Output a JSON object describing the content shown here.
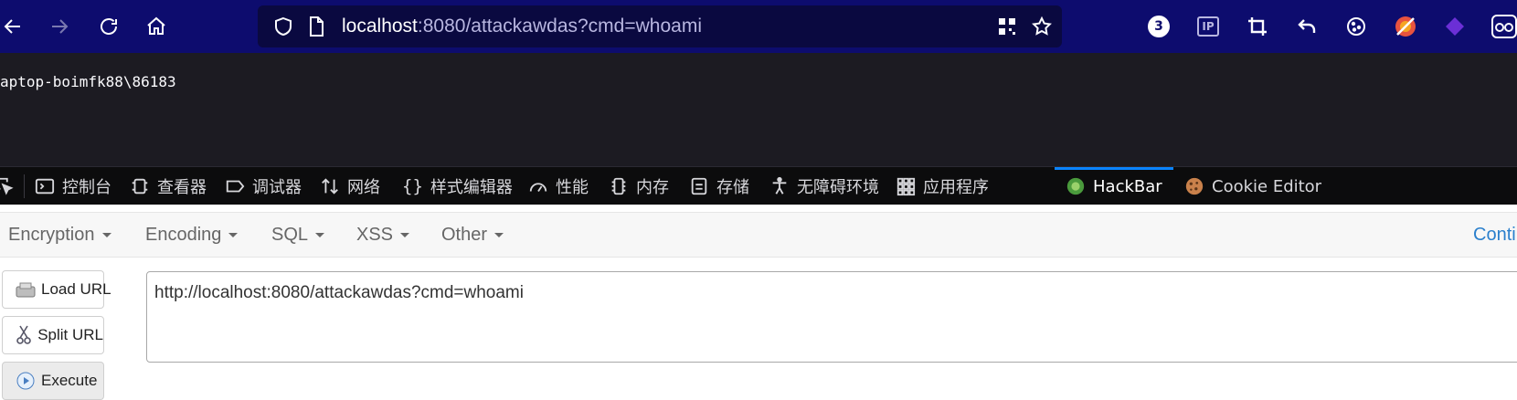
{
  "browser": {
    "url_host": "localhost",
    "url_rest": ":8080/attackawdas?cmd=whoami",
    "badge_count": "3",
    "ext_ip_label": "IP"
  },
  "page": {
    "output_text": "aptop-boimfk88\\86183"
  },
  "devtools": {
    "tabs": [
      {
        "label": "控制台",
        "icon": "console-icon"
      },
      {
        "label": "查看器",
        "icon": "inspector-icon"
      },
      {
        "label": "调试器",
        "icon": "debugger-icon"
      },
      {
        "label": "网络",
        "icon": "network-icon"
      },
      {
        "label": "样式编辑器",
        "icon": "style-editor-icon"
      },
      {
        "label": "性能",
        "icon": "performance-icon"
      },
      {
        "label": "内存",
        "icon": "memory-icon"
      },
      {
        "label": "存储",
        "icon": "storage-icon"
      },
      {
        "label": "无障碍环境",
        "icon": "accessibility-icon"
      },
      {
        "label": "应用程序",
        "icon": "application-icon"
      },
      {
        "label": "HackBar",
        "icon": "hackbar-icon"
      },
      {
        "label": "Cookie Editor",
        "icon": "cookie-icon"
      }
    ],
    "active_tab": "HackBar"
  },
  "hackbar": {
    "menus": [
      "Encryption",
      "Encoding",
      "SQL",
      "XSS",
      "Other"
    ],
    "menu_right": "Conti",
    "buttons": {
      "load": "Load URL",
      "split": "Split URL",
      "execute": "Execute"
    },
    "url_value": "http://localhost:8080/attackawdas?cmd=whoami"
  },
  "colors": {
    "toolbar_bg": "#0d0c6e",
    "content_bg": "#1c1b22",
    "devtools_bg": "#0c0c0d",
    "active_tab_accent": "#0a84ff",
    "link_blue": "#2a7fcc"
  }
}
